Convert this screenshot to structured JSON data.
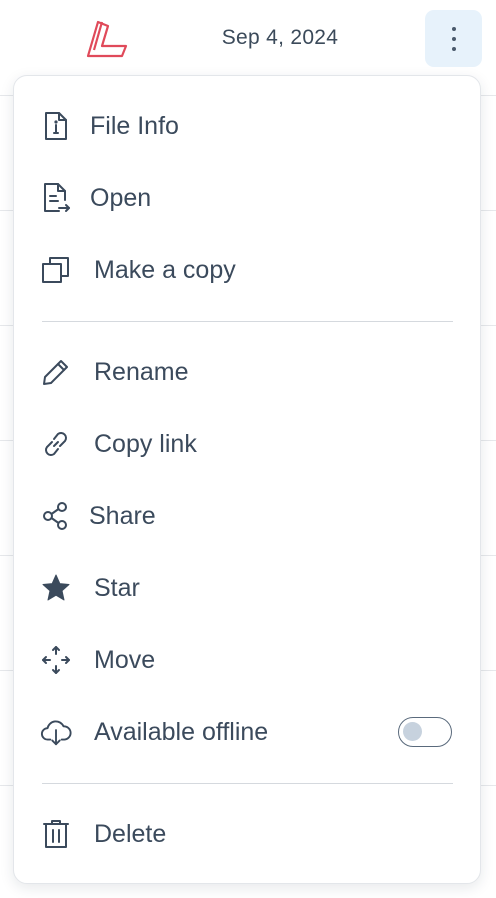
{
  "header": {
    "date": "Sep 4, 2024",
    "logo_color": "#e04a5a",
    "more_button_bg": "#e7f2fb"
  },
  "menu": {
    "items": [
      {
        "label": "File Info",
        "icon": "file-info-icon"
      },
      {
        "label": "Open",
        "icon": "open-file-icon"
      },
      {
        "label": "Make a copy",
        "icon": "copy-icon"
      },
      {
        "label": "Rename",
        "icon": "pencil-icon"
      },
      {
        "label": "Copy link",
        "icon": "link-icon"
      },
      {
        "label": "Share",
        "icon": "share-icon"
      },
      {
        "label": "Star",
        "icon": "star-icon"
      },
      {
        "label": "Move",
        "icon": "move-icon"
      },
      {
        "label": "Available offline",
        "icon": "cloud-download-icon"
      },
      {
        "label": "Delete",
        "icon": "trash-icon"
      }
    ],
    "offline_toggle_on": false
  },
  "colors": {
    "text": "#3b4a5c",
    "icon": "#3b4a5c",
    "divider": "#d5d9de"
  }
}
